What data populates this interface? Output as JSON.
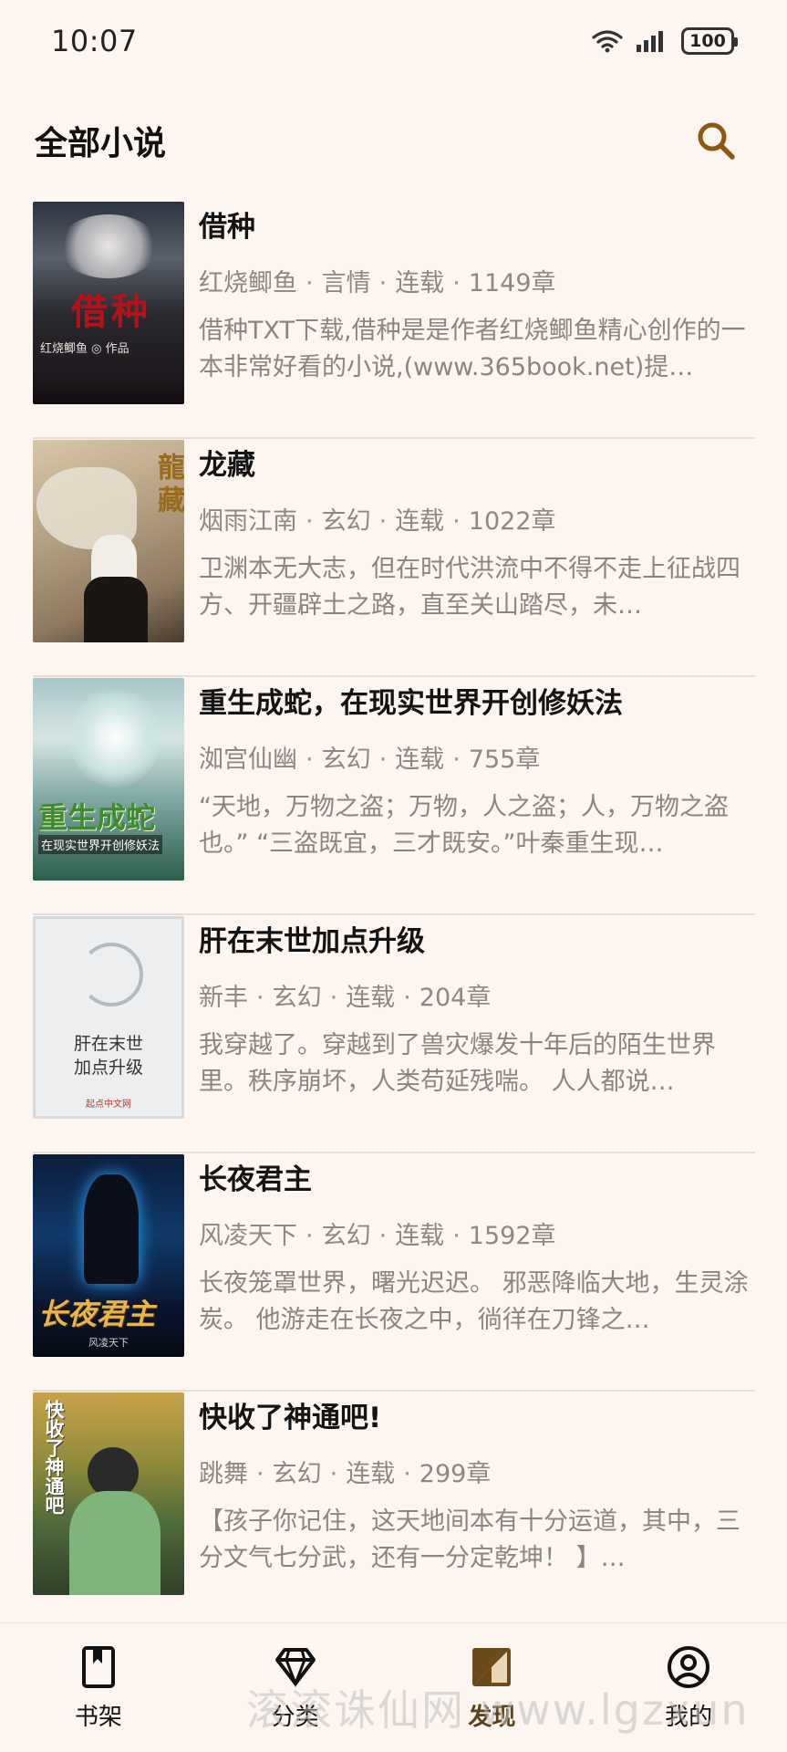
{
  "status": {
    "time": "10:07",
    "battery": "100"
  },
  "header": {
    "title": "全部小说",
    "search_icon": "search-icon",
    "accent": "#8a5a14"
  },
  "books": [
    {
      "title": "借种",
      "author": "红烧鲫鱼",
      "genre": "言情",
      "status": "连载",
      "chapters": "1149章",
      "desc": "借种TXT下载,借种是是作者红烧鲫鱼精心创作的一本非常好看的小说,(www.365book.net)提…",
      "cover_text": "借种",
      "cover_sub": "红烧鲫鱼 ◎ 作品"
    },
    {
      "title": "龙藏",
      "author": "烟雨江南",
      "genre": "玄幻",
      "status": "连载",
      "chapters": "1022章",
      "desc": "卫渊本无大志，但在时代洪流中不得不走上征战四方、开疆辟土之路，直至关山踏尽，未…",
      "cover_text": "龍藏"
    },
    {
      "title": "重生成蛇，在现实世界开创修妖法",
      "author": "洳宫仙幽",
      "genre": "玄幻",
      "status": "连载",
      "chapters": "755章",
      "desc": "“天地，万物之盗；万物，人之盗；人，万物之盗也。” “三盗既宜，三才既安。”叶秦重生现…",
      "cover_text": "重生成蛇",
      "cover_sub": "在现实世界开创修妖法"
    },
    {
      "title": "肝在末世加点升级",
      "author": "新丰",
      "genre": "玄幻",
      "status": "连载",
      "chapters": "204章",
      "desc": "我穿越了。穿越到了兽灾爆发十年后的陌生世界里。秩序崩坏，人类苟延残喘。 人人都说…",
      "cover_text": "肝在末世",
      "cover_sub": "加点升级",
      "cover_brand": "起点中文网"
    },
    {
      "title": "长夜君主",
      "author": "风凌天下",
      "genre": "玄幻",
      "status": "连载",
      "chapters": "1592章",
      "desc": "长夜笼罩世界，曙光迟迟。 邪恶降临大地，生灵涂炭。 他游走在长夜之中，徜徉在刀锋之…",
      "cover_text": "长夜君主",
      "cover_sub": "风凌天下"
    },
    {
      "title": "快收了神通吧!",
      "author": "跳舞",
      "genre": "玄幻",
      "status": "连载",
      "chapters": "299章",
      "desc": "【孩子你记住，这天地间本有十分运道，其中，三分文气七分武，还有一分定乾坤！ 】…",
      "cover_text": "快收了神通吧"
    }
  ],
  "nav": [
    {
      "label": "书架",
      "icon": "bookshelf-icon"
    },
    {
      "label": "分类",
      "icon": "diamond-icon"
    },
    {
      "label": "发现",
      "icon": "discover-icon",
      "active": true
    },
    {
      "label": "我的",
      "icon": "profile-icon"
    }
  ],
  "watermark": "滚滚诛仙网 www.lgzxun"
}
